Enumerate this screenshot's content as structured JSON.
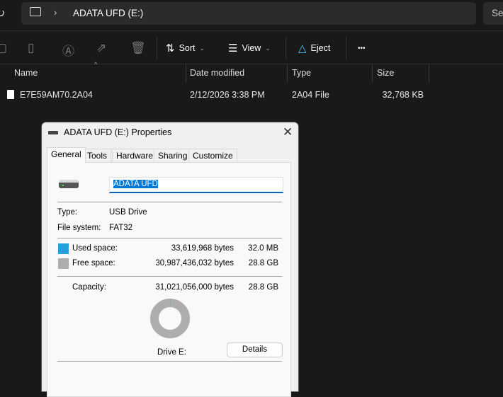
{
  "explorer": {
    "breadcrumb": "ADATA UFD (E:)",
    "search_placeholder": "Se",
    "toolbar": {
      "sort": "Sort",
      "view": "View",
      "eject": "Eject",
      "more": "•••"
    },
    "columns": [
      "Name",
      "Date modified",
      "Type",
      "Size"
    ],
    "files": [
      {
        "name": "E7E59AM70.2A04",
        "date": "2/12/2026 3:38 PM",
        "type": "2A04 File",
        "size": "32,768 KB"
      }
    ]
  },
  "dialog": {
    "title": "ADATA UFD (E:) Properties",
    "tabs": [
      "General",
      "Tools",
      "Hardware",
      "Sharing",
      "Customize"
    ],
    "name_value": "ADATA UFD",
    "type_label": "Type:",
    "type_value": "USB Drive",
    "fs_label": "File system:",
    "fs_value": "FAT32",
    "used_label": "Used space:",
    "used_bytes": "33,619,968 bytes",
    "used_size": "32.0 MB",
    "free_label": "Free space:",
    "free_bytes": "30,987,436,032 bytes",
    "free_size": "28.8 GB",
    "cap_label": "Capacity:",
    "cap_bytes": "31,021,056,000 bytes",
    "cap_size": "28.8 GB",
    "used_fraction": 0.0011,
    "drive_label": "Drive E:",
    "details": "Details",
    "colors": {
      "used": "#26a0da",
      "free": "#adadad"
    }
  }
}
